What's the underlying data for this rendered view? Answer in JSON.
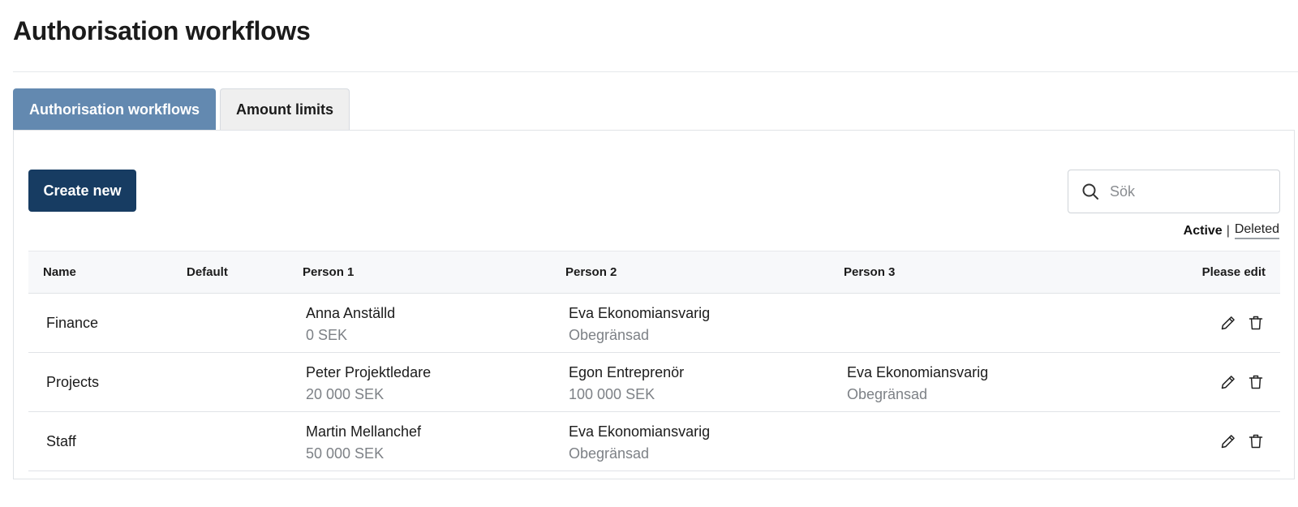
{
  "page": {
    "title": "Authorisation workflows"
  },
  "tabs": [
    {
      "label": "Authorisation workflows",
      "active": true
    },
    {
      "label": "Amount limits",
      "active": false
    }
  ],
  "toolbar": {
    "create_label": "Create new",
    "search_placeholder": "Sök",
    "search_value": "",
    "filter_active": "Active",
    "filter_separator": "|",
    "filter_deleted": "Deleted"
  },
  "table": {
    "headers": {
      "name": "Name",
      "default": "Default",
      "person1": "Person 1",
      "person2": "Person 2",
      "person3": "Person 3",
      "edit": "Please edit"
    },
    "rows": [
      {
        "name": "Finance",
        "person1": {
          "name": "Anna Anställd",
          "limit": "0 SEK"
        },
        "person2": {
          "name": "Eva Ekonomiansvarig",
          "limit": "Obegränsad"
        },
        "person3": {
          "name": "",
          "limit": ""
        }
      },
      {
        "name": "Projects",
        "person1": {
          "name": "Peter Projektledare",
          "limit": "20 000 SEK"
        },
        "person2": {
          "name": "Egon Entreprenör",
          "limit": "100 000 SEK"
        },
        "person3": {
          "name": "Eva Ekonomiansvarig",
          "limit": "Obegränsad"
        }
      },
      {
        "name": "Staff",
        "person1": {
          "name": "Martin Mellanchef",
          "limit": "50 000 SEK"
        },
        "person2": {
          "name": "Eva Ekonomiansvarig",
          "limit": "Obegränsad"
        },
        "person3": {
          "name": "",
          "limit": ""
        }
      }
    ]
  },
  "icons": {
    "search": "search-icon",
    "edit": "pencil-icon",
    "delete": "trash-icon"
  },
  "colors": {
    "tab_active": "#6389b0",
    "tab_inactive": "#efefef",
    "primary_button": "#173c62",
    "muted_text": "#7d8186"
  }
}
